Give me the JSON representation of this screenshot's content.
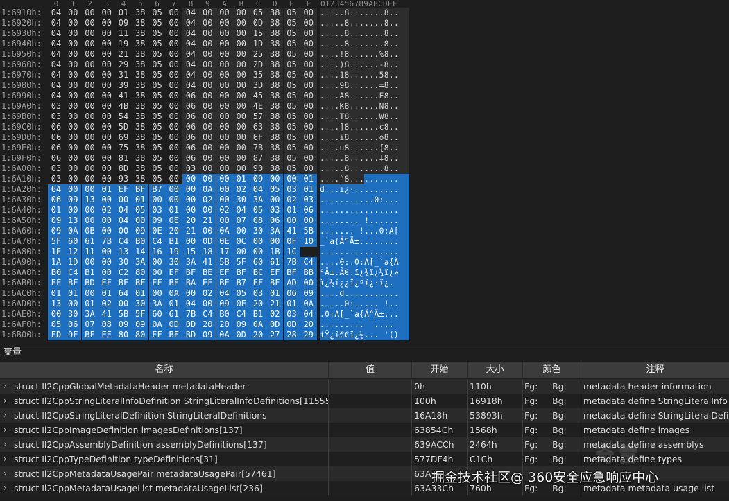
{
  "hex": {
    "header_bytes": [
      "0",
      "1",
      "2",
      "3",
      "4",
      "5",
      "6",
      "7",
      "8",
      "9",
      "A",
      "B",
      "C",
      "D",
      "E",
      "F"
    ],
    "header_ascii": "0123456789ABCDEF",
    "rows": [
      {
        "addr": "1:6910h:",
        "bytes": [
          "04",
          "00",
          "00",
          "00",
          "01",
          "38",
          "05",
          "00",
          "04",
          "00",
          "00",
          "00",
          "05",
          "38",
          "05",
          "00"
        ],
        "ascii": ".....8.......8..",
        "sel": ""
      },
      {
        "addr": "1:6920h:",
        "bytes": [
          "04",
          "00",
          "00",
          "00",
          "09",
          "38",
          "05",
          "00",
          "04",
          "00",
          "00",
          "00",
          "0D",
          "38",
          "05",
          "00"
        ],
        "ascii": ".....8.......8..",
        "sel": ""
      },
      {
        "addr": "1:6930h:",
        "bytes": [
          "04",
          "00",
          "00",
          "00",
          "11",
          "38",
          "05",
          "00",
          "04",
          "00",
          "00",
          "00",
          "15",
          "38",
          "05",
          "00"
        ],
        "ascii": ".....8.......8..",
        "sel": ""
      },
      {
        "addr": "1:6940h:",
        "bytes": [
          "04",
          "00",
          "00",
          "00",
          "19",
          "38",
          "05",
          "00",
          "04",
          "00",
          "00",
          "00",
          "1D",
          "38",
          "05",
          "00"
        ],
        "ascii": ".....8.......8..",
        "sel": ""
      },
      {
        "addr": "1:6950h:",
        "bytes": [
          "04",
          "00",
          "00",
          "00",
          "21",
          "38",
          "05",
          "00",
          "04",
          "00",
          "00",
          "00",
          "25",
          "38",
          "05",
          "00"
        ],
        "ascii": "....!8......%8..",
        "sel": ""
      },
      {
        "addr": "1:6960h:",
        "bytes": [
          "04",
          "00",
          "00",
          "00",
          "29",
          "38",
          "05",
          "00",
          "04",
          "00",
          "00",
          "00",
          "2D",
          "38",
          "05",
          "00"
        ],
        "ascii": "....)8......-8..",
        "sel": ""
      },
      {
        "addr": "1:6970h:",
        "bytes": [
          "04",
          "00",
          "00",
          "00",
          "31",
          "38",
          "05",
          "00",
          "04",
          "00",
          "00",
          "00",
          "35",
          "38",
          "05",
          "00"
        ],
        "ascii": "....18......58..",
        "sel": ""
      },
      {
        "addr": "1:6980h:",
        "bytes": [
          "04",
          "00",
          "00",
          "00",
          "39",
          "38",
          "05",
          "00",
          "04",
          "00",
          "00",
          "00",
          "3D",
          "38",
          "05",
          "00"
        ],
        "ascii": "....98......=8..",
        "sel": ""
      },
      {
        "addr": "1:6990h:",
        "bytes": [
          "04",
          "00",
          "00",
          "00",
          "41",
          "38",
          "05",
          "00",
          "06",
          "00",
          "00",
          "00",
          "45",
          "38",
          "05",
          "00"
        ],
        "ascii": "....A8......E8..",
        "sel": ""
      },
      {
        "addr": "1:69A0h:",
        "bytes": [
          "03",
          "00",
          "00",
          "00",
          "4B",
          "38",
          "05",
          "00",
          "06",
          "00",
          "00",
          "00",
          "4E",
          "38",
          "05",
          "00"
        ],
        "ascii": "....K8......N8..",
        "sel": ""
      },
      {
        "addr": "1:69B0h:",
        "bytes": [
          "03",
          "00",
          "00",
          "00",
          "54",
          "38",
          "05",
          "00",
          "06",
          "00",
          "00",
          "00",
          "57",
          "38",
          "05",
          "00"
        ],
        "ascii": "....T8......W8..",
        "sel": ""
      },
      {
        "addr": "1:69C0h:",
        "bytes": [
          "06",
          "00",
          "00",
          "00",
          "5D",
          "38",
          "05",
          "00",
          "06",
          "00",
          "00",
          "00",
          "63",
          "38",
          "05",
          "00"
        ],
        "ascii": "....]8......c8..",
        "sel": ""
      },
      {
        "addr": "1:69D0h:",
        "bytes": [
          "06",
          "00",
          "00",
          "00",
          "69",
          "38",
          "05",
          "00",
          "06",
          "00",
          "00",
          "00",
          "6F",
          "38",
          "05",
          "00"
        ],
        "ascii": "....i8......o8..",
        "sel": ""
      },
      {
        "addr": "1:69E0h:",
        "bytes": [
          "06",
          "00",
          "00",
          "00",
          "75",
          "38",
          "05",
          "00",
          "06",
          "00",
          "00",
          "00",
          "7B",
          "38",
          "05",
          "00"
        ],
        "ascii": "....u8......{8..",
        "sel": ""
      },
      {
        "addr": "1:69F0h:",
        "bytes": [
          "06",
          "00",
          "00",
          "00",
          "81",
          "38",
          "05",
          "00",
          "06",
          "00",
          "00",
          "00",
          "87",
          "38",
          "05",
          "00"
        ],
        "ascii": ".....8......‡8..",
        "sel": ""
      },
      {
        "addr": "1:6A00h:",
        "bytes": [
          "03",
          "00",
          "00",
          "00",
          "8D",
          "38",
          "05",
          "00",
          "03",
          "00",
          "00",
          "00",
          "90",
          "38",
          "05",
          "00"
        ],
        "ascii": ".....8.......8..",
        "sel": ""
      },
      {
        "addr": "1:6A10h:",
        "bytes": [
          "03",
          "00",
          "00",
          "00",
          "93",
          "38",
          "05",
          "00",
          "00",
          "00",
          "00",
          "01",
          "09",
          "00",
          "00",
          "01"
        ],
        "ascii": "....“8..........",
        "sel": "partial"
      },
      {
        "addr": "1:6A20h:",
        "bytes": [
          "64",
          "00",
          "00",
          "01",
          "EF",
          "BF",
          "B7",
          "00",
          "00",
          "0A",
          "00",
          "02",
          "04",
          "05",
          "03",
          "01"
        ],
        "ascii": "d...ï¿·.........",
        "sel": "full"
      },
      {
        "addr": "1:6A30h:",
        "bytes": [
          "06",
          "09",
          "13",
          "00",
          "00",
          "01",
          "00",
          "00",
          "00",
          "02",
          "00",
          "30",
          "3A",
          "00",
          "02",
          "03"
        ],
        "ascii": "...........0:...",
        "sel": "full"
      },
      {
        "addr": "1:6A40h:",
        "bytes": [
          "01",
          "00",
          "00",
          "02",
          "04",
          "05",
          "03",
          "01",
          "00",
          "00",
          "02",
          "04",
          "05",
          "03",
          "01",
          "06"
        ],
        "ascii": "................",
        "sel": "full"
      },
      {
        "addr": "1:6A50h:",
        "bytes": [
          "09",
          "13",
          "00",
          "00",
          "04",
          "00",
          "09",
          "0E",
          "20",
          "21",
          "00",
          "07",
          "08",
          "06",
          "00",
          "00"
        ],
        "ascii": "........ !......",
        "sel": "full"
      },
      {
        "addr": "1:6A60h:",
        "bytes": [
          "09",
          "0A",
          "0B",
          "00",
          "00",
          "09",
          "0E",
          "20",
          "21",
          "00",
          "0A",
          "00",
          "30",
          "3A",
          "41",
          "5B"
        ],
        "ascii": "....... !...0:A[",
        "sel": "full"
      },
      {
        "addr": "1:6A70h:",
        "bytes": [
          "5F",
          "60",
          "61",
          "7B",
          "C4",
          "B0",
          "C4",
          "B1",
          "00",
          "0D",
          "0E",
          "0C",
          "00",
          "00",
          "0F",
          "10"
        ],
        "ascii": "_`a{Ä°Ä±........",
        "sel": "full"
      },
      {
        "addr": "1:6A80h:",
        "bytes": [
          "1E",
          "12",
          "11",
          "00",
          "13",
          "14",
          "16",
          "19",
          "15",
          "18",
          "17",
          "00",
          "00",
          "1B",
          "1C"
        ],
        "ascii": "................",
        "sel": "full"
      },
      {
        "addr": "1:6A90h:",
        "bytes": [
          "1A",
          "1D",
          "00",
          "00",
          "30",
          "3A",
          "00",
          "30",
          "3A",
          "41",
          "5B",
          "5F",
          "60",
          "61",
          "7B",
          "C4"
        ],
        "ascii": "....0:.0:A[_`a{Ä",
        "sel": "full"
      },
      {
        "addr": "1:6AA0h:",
        "bytes": [
          "B0",
          "C4",
          "B1",
          "00",
          "C2",
          "80",
          "00",
          "EF",
          "BF",
          "BE",
          "EF",
          "BF",
          "BC",
          "EF",
          "BF",
          "BB"
        ],
        "ascii": "°Ä±.Â€.ï¿¾ï¿¼ï¿»",
        "sel": "full"
      },
      {
        "addr": "1:6AB0h:",
        "bytes": [
          "EF",
          "BF",
          "BD",
          "EF",
          "BF",
          "BF",
          "EF",
          "BF",
          "BA",
          "EF",
          "BF",
          "B7",
          "EF",
          "BF",
          "AD",
          "00"
        ],
        "ascii": "ï¿½ï¿¿ï¿ºï¿·ï¿­.",
        "sel": "full"
      },
      {
        "addr": "1:6AC0h:",
        "bytes": [
          "01",
          "01",
          "00",
          "01",
          "64",
          "01",
          "00",
          "0A",
          "00",
          "02",
          "04",
          "05",
          "03",
          "01",
          "06",
          "09"
        ],
        "ascii": "....d...........",
        "sel": "full"
      },
      {
        "addr": "1:6AD0h:",
        "bytes": [
          "13",
          "00",
          "01",
          "02",
          "00",
          "30",
          "3A",
          "01",
          "04",
          "00",
          "09",
          "0E",
          "20",
          "21",
          "01",
          "0A"
        ],
        "ascii": ".....0:..... !..",
        "sel": "full"
      },
      {
        "addr": "1:6AE0h:",
        "bytes": [
          "00",
          "30",
          "3A",
          "41",
          "5B",
          "5F",
          "60",
          "61",
          "7B",
          "C4",
          "B0",
          "C4",
          "B1",
          "02",
          "03",
          "04"
        ],
        "ascii": ".0:A[_`a{Ä°Ä±...",
        "sel": "full"
      },
      {
        "addr": "1:6AF0h:",
        "bytes": [
          "05",
          "06",
          "07",
          "08",
          "09",
          "09",
          "0A",
          "0D",
          "0D",
          "20",
          "20",
          "09",
          "0A",
          "0D",
          "0D",
          "20"
        ],
        "ascii": ".........  .... ",
        "sel": "full"
      },
      {
        "addr": "1:6B00h:",
        "bytes": [
          "ED",
          "9F",
          "BF",
          "EE",
          "80",
          "80",
          "EF",
          "BF",
          "BD",
          "09",
          "0A",
          "0D",
          "20",
          "27",
          "28",
          "29"
        ],
        "ascii": "íŸ¿î€€ï¿½... '()",
        "sel": "full"
      }
    ]
  },
  "vars": {
    "panel_title": "变量",
    "columns": [
      "名称",
      "值",
      "开始",
      "大小",
      "颜色",
      "注释"
    ],
    "rows": [
      {
        "name": "struct Il2CppGlobalMetadataHeader metadataHeader",
        "value": "",
        "start": "0h",
        "size": "110h",
        "fg": "Fg:",
        "bg": "Bg:",
        "comment": "metadata header information"
      },
      {
        "name": "struct Il2CppStringLiteralInfoDefinition StringLiteralInfoDefinitions[11555]",
        "value": "",
        "start": "100h",
        "size": "16918h",
        "fg": "Fg:",
        "bg": "Bg:",
        "comment": "metadata define StringLiteralInfo"
      },
      {
        "name": "struct Il2CppStringLiteralDefinition StringLiteralDefinitions",
        "value": "",
        "start": "16A18h",
        "size": "53893h",
        "fg": "Fg:",
        "bg": "Bg:",
        "comment": "metadata define StringLiteralDefi..."
      },
      {
        "name": "struct Il2CppImageDefinition imagesDefinitions[137]",
        "value": "",
        "start": "63854Ch",
        "size": "1568h",
        "fg": "Fg:",
        "bg": "Bg:",
        "comment": "metadata define images"
      },
      {
        "name": "struct Il2CppAssemblyDefinition assemblyDefinitions[137]",
        "value": "",
        "start": "639ACCh",
        "size": "2464h",
        "fg": "Fg:",
        "bg": "Bg:",
        "comment": "metadata define assemblys"
      },
      {
        "name": "struct Il2CppTypeDefinition typeDefinitions[31]",
        "value": "",
        "start": "577DF4h",
        "size": "C1Ch",
        "fg": "Fg:",
        "bg": "Bg:",
        "comment": "metadata define types"
      },
      {
        "name": "struct Il2CppMetadataUsagePair metadataUsagePair[57461]",
        "value": "",
        "start": "63A",
        "size": "",
        "fg": "",
        "bg": "",
        "comment": ""
      },
      {
        "name": "struct Il2CppMetadataUsageList metadataUsageList[236]",
        "value": "",
        "start": "63A33Ch",
        "size": "760h",
        "fg": "Fg:",
        "bg": "Bg:",
        "comment": "metadata metadata usage list"
      }
    ]
  },
  "watermark": {
    "text": "掘金技术社区@ 360安全应急响应中心",
    "logo": "奇雷"
  }
}
